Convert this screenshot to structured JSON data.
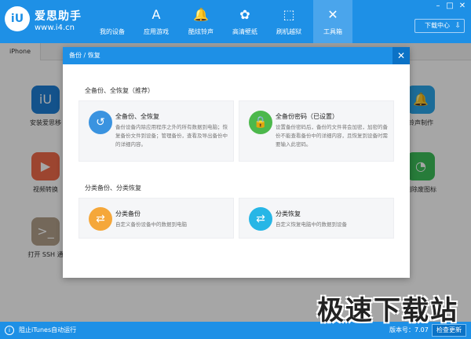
{
  "app": {
    "logo_text": "iU",
    "name": "爱思助手",
    "url": "www.i4.cn"
  },
  "nav": [
    {
      "label": "我的设备",
      "icon": ""
    },
    {
      "label": "应用游戏",
      "icon": "A"
    },
    {
      "label": "酷炫铃声",
      "icon": "🔔"
    },
    {
      "label": "高清壁纸",
      "icon": "✿"
    },
    {
      "label": "刷机越狱",
      "icon": "⬚"
    },
    {
      "label": "工具箱",
      "icon": "✕"
    }
  ],
  "window_controls": {
    "minimize": "–",
    "maximize": "□",
    "close": "✕"
  },
  "download": {
    "label": "下载中心",
    "icon": "⇩"
  },
  "tabs": [
    "iPhone"
  ],
  "tools": [
    {
      "label": "安装爱思移",
      "icon": "iU",
      "color": "#1e7fd6"
    },
    {
      "label": "视频转换",
      "icon": "▶",
      "color": "#f06a4b"
    },
    {
      "label": "打开 SSH 通",
      "icon": ">_",
      "color": "#b3a08a"
    },
    {
      "label": "铃声制作",
      "icon": "🔔",
      "color": "#2ba7ea"
    },
    {
      "label": "删除废图标",
      "icon": "◔",
      "color": "#3cbf5a"
    }
  ],
  "modal": {
    "title": "备份 / 恢复",
    "close": "✕",
    "section1": "全备份、全恢复（推荐）",
    "section2": "分类备份、分类恢复",
    "cards": [
      {
        "title": "全备份、全恢复",
        "desc": "备份设备内除应用程序之外的所有数据到电脑；恢复备份文件到设备；管理备份，查看及导出备份中的详细内容。",
        "icon": "↺",
        "color": "#3a93e0"
      },
      {
        "title": "全备份密码（已设置）",
        "desc": "设置备份密码后，备份的文件将会加密，加密的备份不能查看备份中的详细内容，且恢复到设备时需要输入此密码。",
        "icon": "🔒",
        "color": "#4cb84c"
      },
      {
        "title": "分类备份",
        "desc": "自定义备份设备中的数据到电脑",
        "icon": "⇄",
        "color": "#f5a73a"
      },
      {
        "title": "分类恢复",
        "desc": "自定义恢复电脑中的数据到设备",
        "icon": "⇄",
        "color": "#27b6e6"
      }
    ]
  },
  "statusbar": {
    "icon": "i",
    "left_text": "阻止iTunes自动运行",
    "version": "版本号：7.07",
    "update_button": "检查更新"
  },
  "watermark": "极速下载站"
}
